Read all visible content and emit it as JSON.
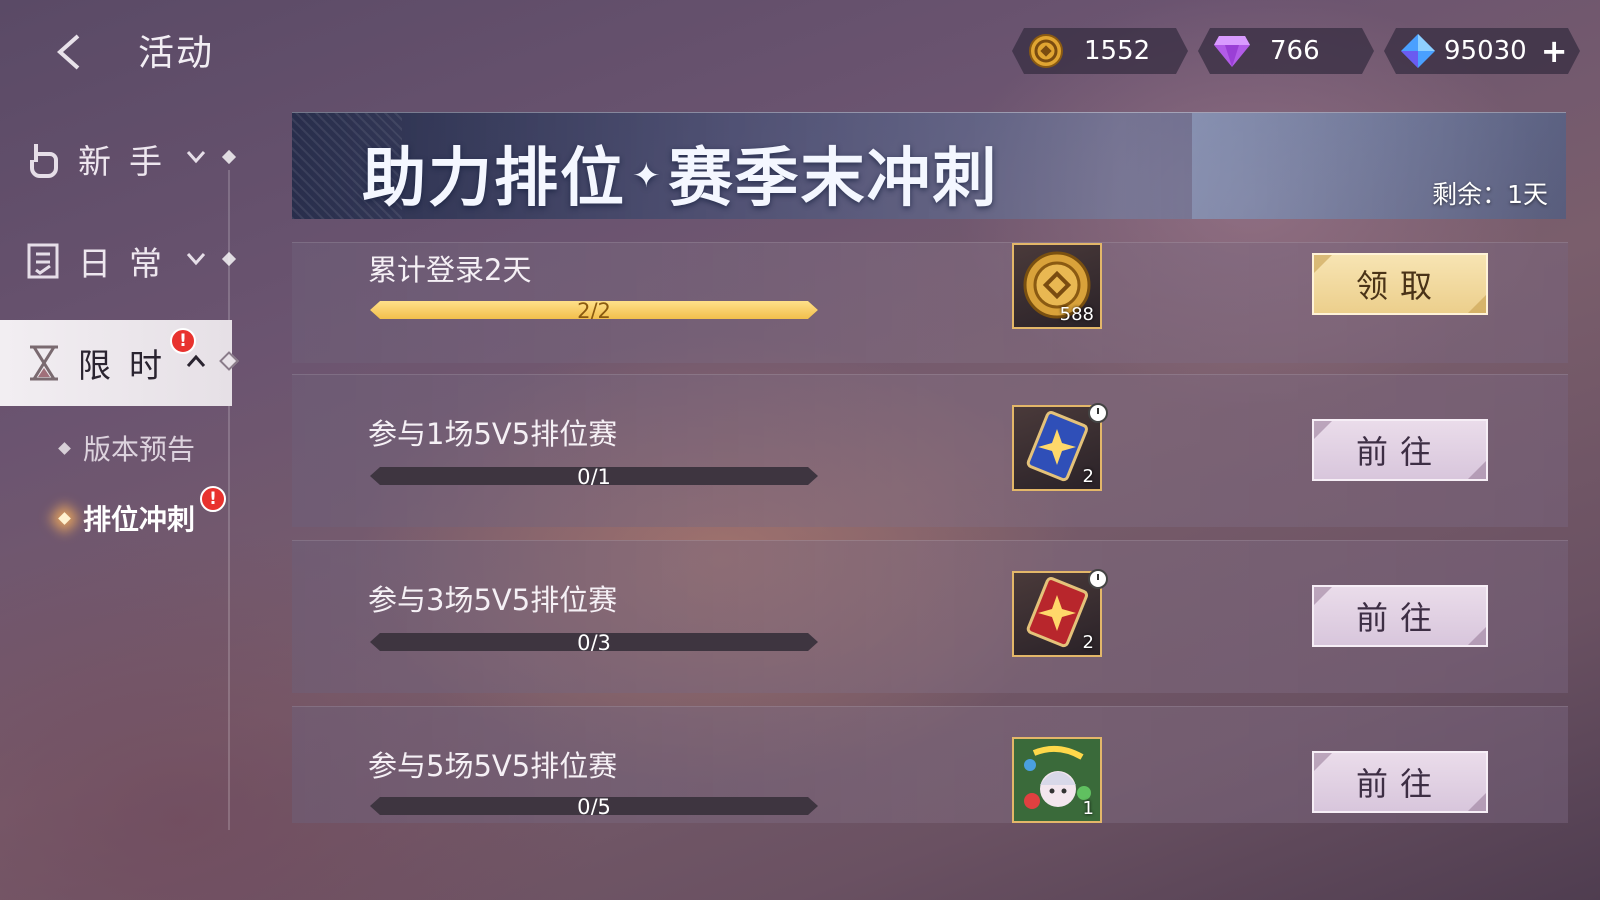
{
  "header": {
    "title": "活动",
    "currencies": [
      {
        "name": "gold-coin",
        "value": "1552",
        "icon": "gold-coin-icon"
      },
      {
        "name": "purple-gem",
        "value": "766",
        "icon": "purple-diamond-icon"
      },
      {
        "name": "crystal",
        "value": "95030",
        "icon": "blue-crystal-icon",
        "plus": "+"
      }
    ]
  },
  "sidebar": {
    "categories": [
      {
        "label": "新手",
        "icon": "hand-icon"
      },
      {
        "label": "日常",
        "icon": "checklist-icon"
      },
      {
        "label": "限时",
        "icon": "hourglass-icon",
        "badge": "!"
      }
    ],
    "sub_items": [
      {
        "label": "版本预告"
      },
      {
        "label": "排位冲刺",
        "badge": "!"
      }
    ]
  },
  "banner": {
    "title_part1": "助力排位",
    "separator": "✦",
    "title_part2": "赛季末冲刺",
    "remaining": "剩余：1天"
  },
  "tasks": [
    {
      "name": "累计登录2天",
      "progress_text": "2/2",
      "progress": 1.0,
      "reward_qty": "588",
      "reward_icon": "gold-coin-icon",
      "button": "领取"
    },
    {
      "name": "参与1场5V5排位赛",
      "progress_text": "0/1",
      "progress": 0.0,
      "reward_qty": "2",
      "reward_icon": "blue-card-icon",
      "button": "前往"
    },
    {
      "name": "参与3场5V5排位赛",
      "progress_text": "0/3",
      "progress": 0.0,
      "reward_qty": "2",
      "reward_icon": "red-card-icon",
      "button": "前往"
    },
    {
      "name": "参与5场5V5排位赛",
      "progress_text": "0/5",
      "progress": 0.0,
      "reward_qty": "1",
      "reward_icon": "character-avatar-icon",
      "button": "前往"
    }
  ],
  "colors": {
    "accent_gold": "#f2bf4c",
    "badge_red": "#e8322e"
  }
}
